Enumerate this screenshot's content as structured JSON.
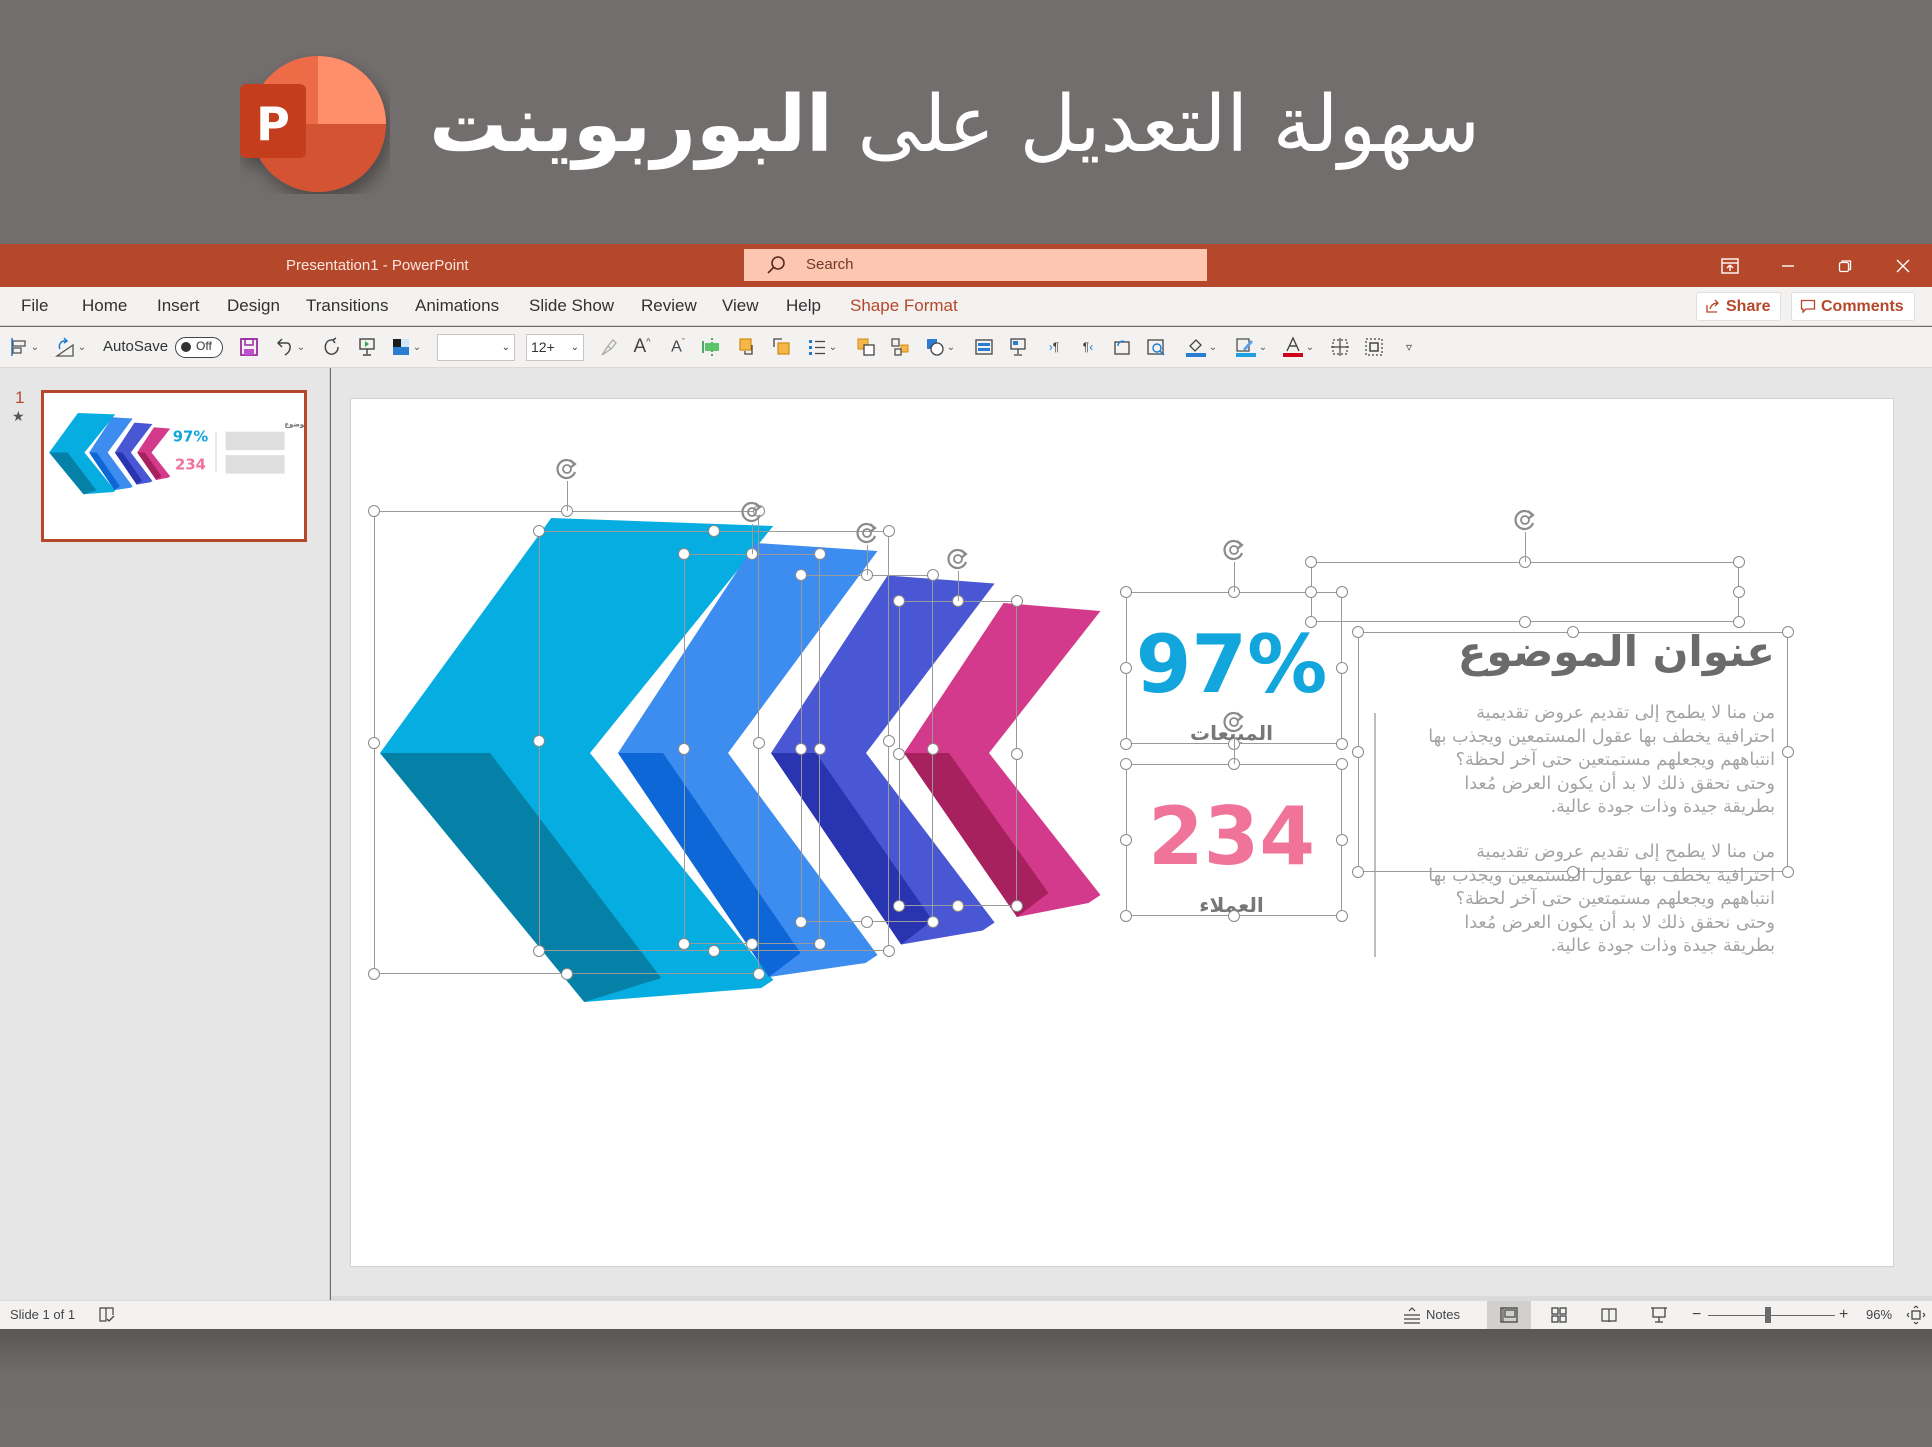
{
  "banner": {
    "title_regular": "سهولة التعديل على",
    "title_bold": "البوربوينت",
    "logo_letter": "P",
    "logo_icon": "powerpoint-logo-icon"
  },
  "titlebar": {
    "document_title": "Presentation1  -  PowerPoint",
    "search_placeholder": "Search",
    "window_controls": [
      "ribbon-display-options-icon",
      "minimize-icon",
      "restore-icon",
      "close-icon"
    ]
  },
  "menu": {
    "items": [
      "File",
      "Home",
      "Insert",
      "Design",
      "Transitions",
      "Animations",
      "Slide Show",
      "Review",
      "View",
      "Help",
      "Shape Format"
    ],
    "active": "Shape Format",
    "share_label": "Share",
    "comments_label": "Comments"
  },
  "toolbar": {
    "autosave_label": "AutoSave",
    "autosave_state": "Off",
    "font_name": "",
    "font_size": "12+",
    "icons": [
      "align-icon",
      "rotate-icon",
      "save-icon",
      "undo-icon",
      "redo-icon",
      "from-beginning-icon",
      "theme-colors-icon",
      "format-painter-icon",
      "increase-font-icon",
      "decrease-font-icon",
      "align-center-icon",
      "bring-forward-icon",
      "send-backward-icon",
      "bullets-icon",
      "group-icon",
      "ungroup-icon",
      "shapes-icon",
      "text-box-icon",
      "present-online-icon",
      "ltr-icon",
      "rtl-icon",
      "replace-icon",
      "find-icon",
      "shape-fill-icon",
      "shape-outline-icon",
      "font-color-icon",
      "selection-pane-icon",
      "crop-icon",
      "customize-toolbar-icon"
    ],
    "colors": {
      "fill": "#2b7cd3",
      "outline": "#1ea1e3",
      "font": "#d0021b"
    }
  },
  "thumbnails": [
    {
      "number": "1",
      "has_animation": true,
      "selected": true
    }
  ],
  "slide": {
    "topic_title": "عنوان الموضوع",
    "paragraphs": [
      "من منا لا يطمح إلى تقديم عروض تقديمية احترافية يخطف بها عقول المستمعين ويجذب بها انتباههم ويجعلهم مستمتعين حتى آخر لحظة؟ وحتى نحقق ذلك لا بد أن يكون العرض مُعدا بطريقة جيدة وذات جودة عالية.",
      "من منا لا يطمح إلى تقديم عروض تقديمية احترافية يخطف بها عقول المستمعين ويجذب بها انتباههم ويجعلهم مستمتعين حتى آخر لحظة؟ وحتى نحقق ذلك لا بد أن يكون العرض مُعدا بطريقة جيدة وذات جودة عالية."
    ],
    "stats": [
      {
        "value": "97%",
        "label": "المبيعات",
        "color": "#12a6dc"
      },
      {
        "value": "234",
        "label": "العملاء",
        "color": "#f0739a"
      }
    ],
    "chevrons": [
      {
        "name": "cyan",
        "face": "#05ade0",
        "side": "#0581a8"
      },
      {
        "name": "blue",
        "face": "#3d8cf0",
        "side": "#0e67d6"
      },
      {
        "name": "indigo",
        "face": "#4a57d4",
        "side": "#2834b0"
      },
      {
        "name": "magenta",
        "face": "#d43a8c",
        "side": "#a8215f"
      }
    ]
  },
  "statusbar": {
    "slide_indicator": "Slide 1 of 1",
    "notes_label": "Notes",
    "zoom_level": "96%",
    "zoom_fraction": 0.47,
    "view_buttons": [
      "normal-view",
      "slide-sorter-view",
      "reading-view",
      "slide-show-view"
    ],
    "active_view": "normal-view"
  },
  "theme": {
    "accent": "#b5472b",
    "search_bg": "#fcc6b1",
    "banner_bg": "#736e6e"
  }
}
